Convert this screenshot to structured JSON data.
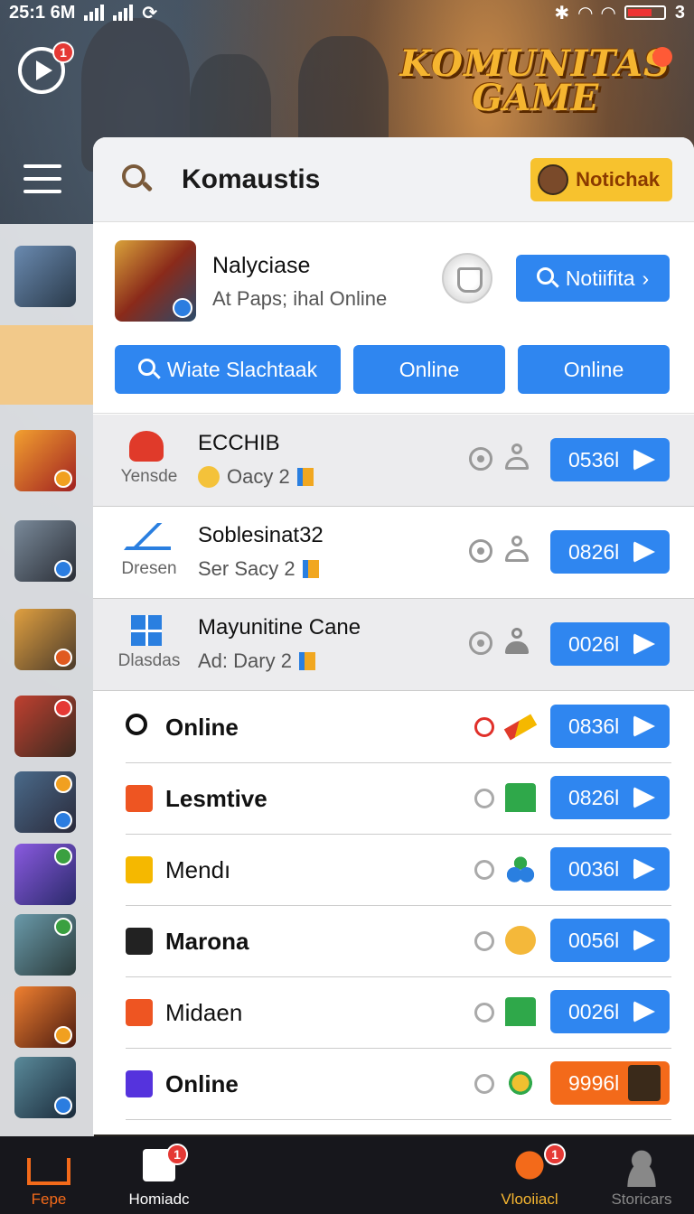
{
  "status_bar": {
    "time": "25:1 6M",
    "battery_level": "3"
  },
  "header": {
    "brand_line1": "KOMUNITAS",
    "brand_line2": "GAME",
    "play_badge_count": "1"
  },
  "search": {
    "title": "Komaustis",
    "notif_label": "Notichak"
  },
  "profile": {
    "name": "Nalyciase",
    "status": "At Paps; ihal Online",
    "notify_button": "Notiifita",
    "actions": [
      "Wiate Slachtaak",
      "Online",
      "Online"
    ]
  },
  "friends": [
    {
      "icon": "game-logo-icon",
      "label": "Yensde",
      "name": "ECCHIB",
      "sub": "Oacy 2",
      "count": "0536l"
    },
    {
      "icon": "sail-logo-icon",
      "label": "Dresen",
      "name": "Soblesinat32",
      "sub": "Ser Sacy 2",
      "count": "0826l"
    },
    {
      "icon": "windows-logo-icon",
      "label": "Dlasdas",
      "name": "Mayunitine Cane",
      "sub": "Ad: Dary 2",
      "count": "0026l"
    }
  ],
  "games": [
    {
      "icon": "search-icon",
      "name": "Online",
      "count": "0836l",
      "color": "#111111",
      "status": "red"
    },
    {
      "icon": "play-icon",
      "name": "Lesmtive",
      "count": "0826l",
      "color": "#ee5522",
      "status": "grey"
    },
    {
      "icon": "play-icon",
      "name": "Mendı",
      "count": "0036l",
      "color": "#f5b800",
      "status": "grey"
    },
    {
      "icon": "j-icon",
      "name": "Marona",
      "count": "0056l",
      "color": "#222222",
      "status": "grey"
    },
    {
      "icon": "controller-icon",
      "name": "Midaen",
      "count": "0026l",
      "color": "#ee5522",
      "status": "grey"
    },
    {
      "icon": "play-icon",
      "name": "Online",
      "count": "9996l",
      "color": "#5533dd",
      "status": "grey"
    }
  ],
  "bottom_nav": [
    {
      "label": "Fepe",
      "active": true,
      "badge": ""
    },
    {
      "label": "Homiadc",
      "active": false,
      "badge": "1"
    },
    {
      "label": "Vlooiiacl",
      "active": false,
      "badge": "1"
    },
    {
      "label": "Storicars",
      "active": false,
      "badge": ""
    }
  ],
  "colors": {
    "accent_blue": "#2f86f0",
    "accent_orange": "#f36a1a",
    "brand_gold": "#f5b530",
    "badge_red": "#e53935"
  }
}
